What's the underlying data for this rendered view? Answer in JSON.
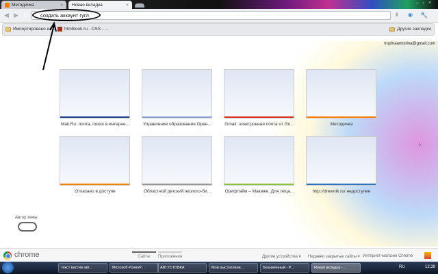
{
  "tabs": [
    {
      "label": "Методичка",
      "active": false
    },
    {
      "label": "Новая вкладка",
      "active": true
    }
  ],
  "omnibox": {
    "value": "создать аккаунт гугл"
  },
  "bookmarks": {
    "items": [
      "Импортировано из...",
      "htmlbook.ru - CSS - ..."
    ],
    "other": "Другие закладки"
  },
  "user_email": "tropinaantonina@gmail.com",
  "thumbnails": [
    {
      "label": "Mail.Ru: почта, поиск в интерне...",
      "color": "#1a3c8c"
    },
    {
      "label": "Управление образования Орен...",
      "color": "#8aa0d0"
    },
    {
      "label": "Gmail: электронная почта от Go...",
      "color": "#d03020"
    },
    {
      "label": "Методичка",
      "color": "#f57d00"
    },
    {
      "label": "Отказано в доступе",
      "color": "#f57d00"
    },
    {
      "label": "Областной детский эколого-би...",
      "color": "#999999"
    },
    {
      "label": "Орифлэйм – Макияж. Для лица...",
      "color": "#8cc63f"
    },
    {
      "label": "http://dnevnik.ru/ недоступен",
      "color": "#3070c0"
    }
  ],
  "theme_author": "Автор темы:",
  "footer": {
    "brand": "chrome",
    "tabs": [
      "Сайты",
      "Приложения"
    ],
    "links": [
      "Другие устройства ▾",
      "Недавно закрытые сайты ▾",
      "Интернет-магазин Chrome"
    ]
  },
  "taskbar": {
    "items": [
      "текст вистив авт...",
      "Microsoft PowerP...",
      "АВГУСТОВКА",
      "Мои выступлени...",
      "Безымянный - P...",
      "Новая вкладка - ..."
    ],
    "lang": "RU",
    "time": "12:39"
  }
}
